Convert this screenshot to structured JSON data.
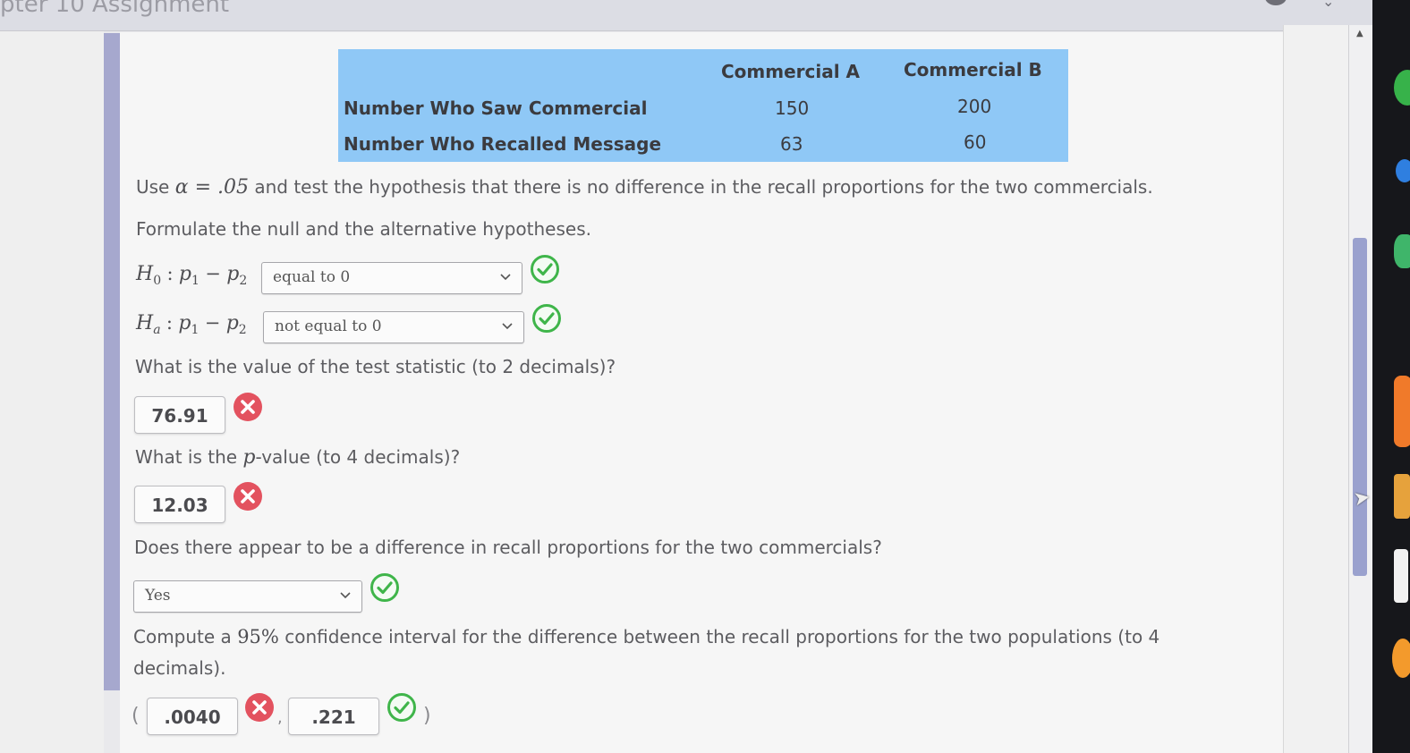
{
  "window": {
    "title": "pter 10 Assignment"
  },
  "table": {
    "headers": [
      "Commercial A",
      "Commercial B"
    ],
    "rows": [
      {
        "label": "Number Who Saw Commercial",
        "a": "150",
        "b": "200"
      },
      {
        "label": "Number Who Recalled Message",
        "a": "63",
        "b": "60"
      }
    ]
  },
  "question": {
    "intro_pre": "Use",
    "alpha_expr": "α = .05",
    "intro_post": "and test the hypothesis that there is no difference in the recall proportions for the two commercials.",
    "formulate": "Formulate the null and the alternative hypotheses.",
    "h0_symbol": "H",
    "h0_sub": "0",
    "ha_symbol": "H",
    "ha_sub": "a",
    "h_expr_p1": "p",
    "h_expr_p1_sub": "1",
    "h_expr_minus": "−",
    "h_expr_p2": "p",
    "h_expr_p2_sub": "2",
    "h_colon": ":",
    "h0_value": "equal to 0",
    "ha_value": "not equal to 0",
    "test_stat_q": "What is the value of the test statistic (to 2 decimals)?",
    "test_stat_value": "76.91",
    "pvalue_q_pre": "What is the",
    "pvalue_q_p": "p",
    "pvalue_q_post": "-value (to 4 decimals)?",
    "pvalue_value": "12.03",
    "difference_q": "Does there appear to be a difference in recall proportions for the two commercials?",
    "difference_value": "Yes",
    "ci_q_pre": "Compute a",
    "ci_q_pct": "95%",
    "ci_q_post": "confidence interval for the difference between the recall proportions for the two populations (to 4",
    "ci_q_line2": "decimals).",
    "ci_open": "(",
    "ci_comma": ",",
    "ci_close": ")",
    "ci_lower": ".0040",
    "ci_upper": ".221"
  },
  "status": {
    "correct_color": "#3fb54a",
    "incorrect_color": "#e3525f"
  }
}
